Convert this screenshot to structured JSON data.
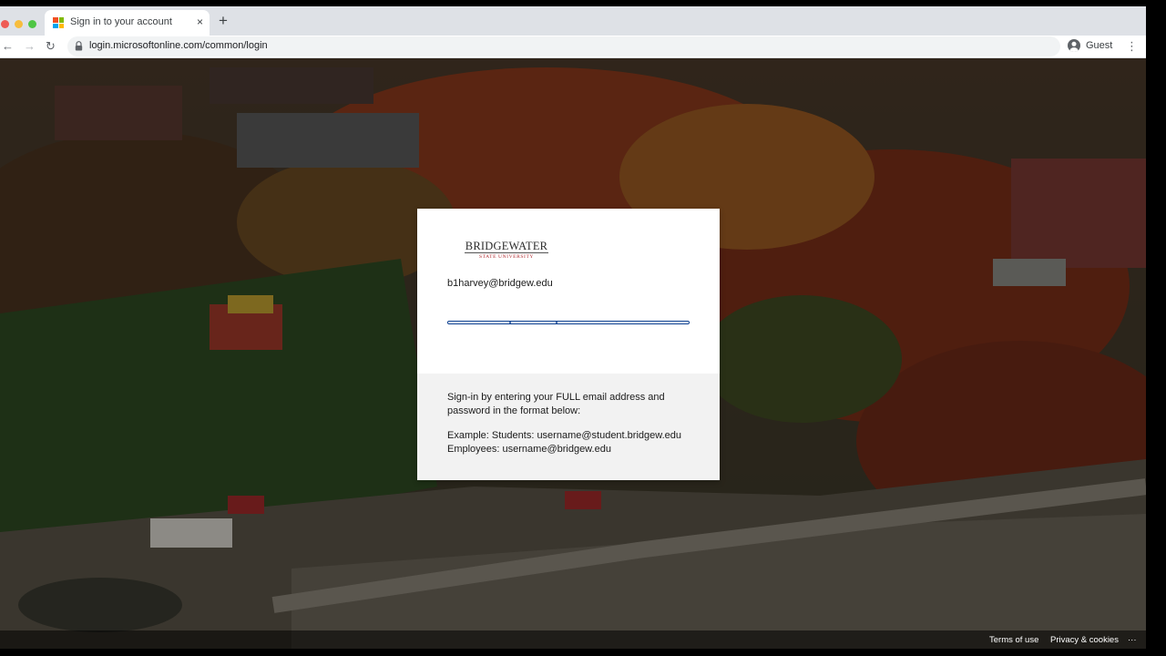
{
  "browser": {
    "tab_title": "Sign in to your account",
    "tab_close": "×",
    "new_tab": "+",
    "back": "←",
    "forward": "→",
    "reload": "↻",
    "url": "login.microsoftonline.com/common/login",
    "profile_label": "Guest",
    "menu": "⋮"
  },
  "card": {
    "logo_main": "BRIDGEWATER",
    "logo_sub": "STATE UNIVERSITY",
    "identity": "b1harvey@bridgew.edu",
    "hint_line1": "Sign-in by entering your FULL email address and",
    "hint_line2": "password in the format below:",
    "example_line1": "Example: Students: username@student.bridgew.edu",
    "example_line2": "Employees: username@bridgew.edu"
  },
  "footer": {
    "terms": "Terms of use",
    "privacy": "Privacy & cookies",
    "more": "···"
  },
  "colors": {
    "accent": "#0b3f8f",
    "logo_red": "#b0282e",
    "ms_red": "#f25022",
    "ms_green": "#7fba00",
    "ms_blue": "#00a4ef",
    "ms_yellow": "#ffb900"
  }
}
